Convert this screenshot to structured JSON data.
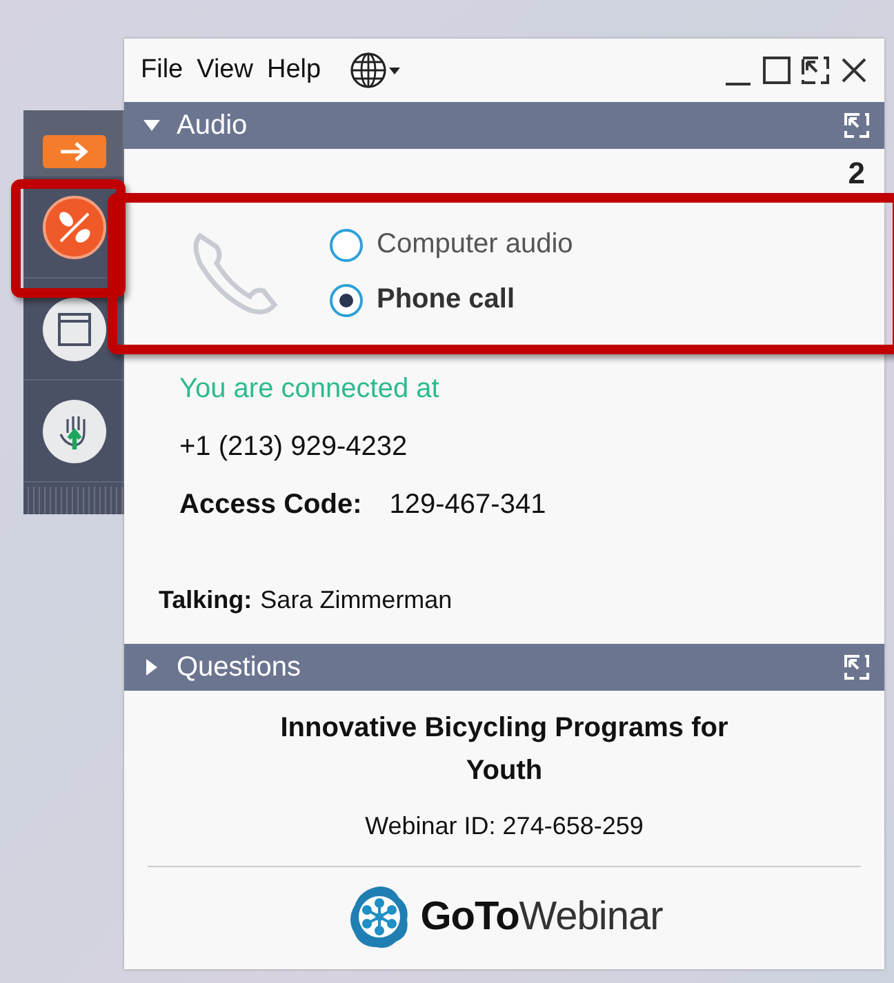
{
  "menu": {
    "items": [
      "File",
      "View",
      "Help"
    ]
  },
  "sidebar": {
    "items": [
      {
        "kind": "arrow"
      },
      {
        "kind": "audio"
      },
      {
        "kind": "window"
      },
      {
        "kind": "hand"
      }
    ]
  },
  "audio": {
    "title": "Audio",
    "expanded": true,
    "count": "2",
    "options": [
      {
        "label": "Computer audio",
        "selected": false
      },
      {
        "label": "Phone call",
        "selected": true
      }
    ],
    "status": "You are connected at",
    "phone": "+1 (213) 929-4232",
    "access_code_label": "Access Code:",
    "access_code": "129-467-341",
    "talking_label": "Talking:",
    "talking_name": "Sara Zimmerman"
  },
  "questions": {
    "title": "Questions",
    "expanded": false
  },
  "webinar": {
    "title": "Innovative Bicycling Programs for Youth",
    "id": "Webinar ID: 274-658-259"
  },
  "logo": {
    "strong": "GoTo",
    "light": "Webinar"
  }
}
